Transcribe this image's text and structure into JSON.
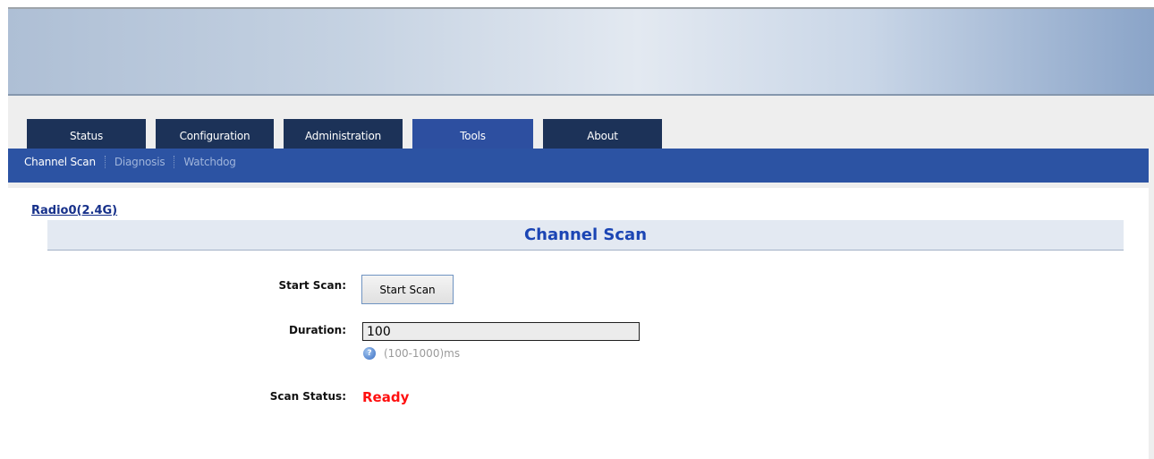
{
  "tabs": [
    {
      "label": "Status"
    },
    {
      "label": "Configuration"
    },
    {
      "label": "Administration"
    },
    {
      "label": "Tools"
    },
    {
      "label": "About"
    }
  ],
  "active_tab": "Tools",
  "subnav": [
    {
      "label": "Channel Scan"
    },
    {
      "label": "Diagnosis"
    },
    {
      "label": "Watchdog"
    }
  ],
  "active_subnav": "Channel Scan",
  "radio_link": "Radio0(2.4G)",
  "section_title": "Channel Scan",
  "form": {
    "start_scan_label": "Start Scan:",
    "start_scan_button": "Start Scan",
    "duration_label": "Duration:",
    "duration_value": "100",
    "duration_hint": "(100-1000)ms",
    "scan_status_label": "Scan Status:",
    "scan_status_value": "Ready"
  },
  "colors": {
    "tab_bg": "#1c3258",
    "tab_active_bg": "#2d4fa0",
    "subnav_bg": "#2c53a3",
    "section_title": "#1b45b4",
    "status_ready": "#ff1010"
  },
  "icons": {
    "help": "help-icon"
  }
}
